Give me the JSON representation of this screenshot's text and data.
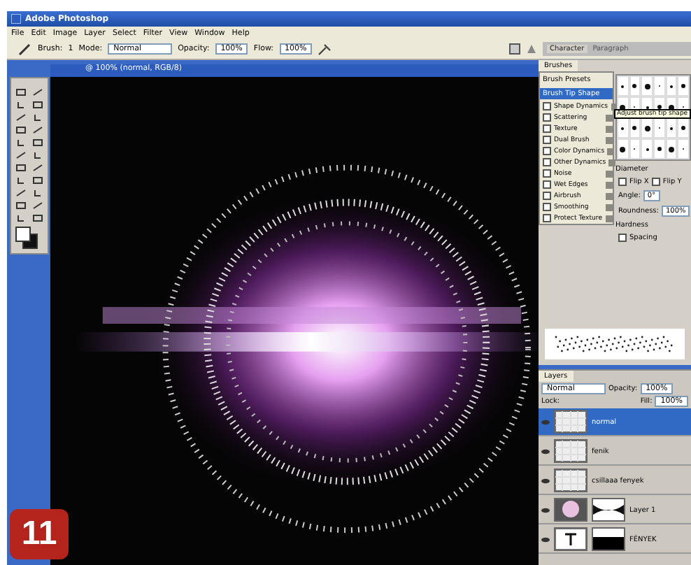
{
  "window": {
    "title": "Adobe Photoshop"
  },
  "menu": [
    "File",
    "Edit",
    "Image",
    "Layer",
    "Select",
    "Filter",
    "View",
    "Window",
    "Help"
  ],
  "options_bar": {
    "brush_label": "Brush:",
    "brush_size": "1",
    "mode_label": "Mode:",
    "mode": "Normal",
    "opacity_label": "Opacity:",
    "opacity": "100%",
    "flow_label": "Flow:",
    "flow": "100%"
  },
  "palette_tabs": [
    {
      "label": "Character",
      "selected": true
    },
    {
      "label": "Paragraph",
      "selected": false
    }
  ],
  "document": {
    "title": "@ 100% (normal, RGB/8)"
  },
  "brushes": {
    "title": "Brushes",
    "presets": "Brush Presets",
    "tip_shape": {
      "label": "Brush Tip Shape",
      "selected": true
    },
    "options": [
      {
        "label": "Shape Dynamics",
        "checked": false,
        "locked": true
      },
      {
        "label": "Scattering",
        "checked": false,
        "locked": true
      },
      {
        "label": "Texture",
        "checked": false,
        "locked": true
      },
      {
        "label": "Dual Brush",
        "checked": false,
        "locked": true
      },
      {
        "label": "Color Dynamics",
        "checked": false,
        "locked": true
      },
      {
        "label": "Other Dynamics",
        "checked": false,
        "locked": true
      },
      {
        "label": "Noise",
        "checked": false,
        "locked": true
      },
      {
        "label": "Wet Edges",
        "checked": false,
        "locked": true
      },
      {
        "label": "Airbrush",
        "checked": false,
        "locked": true
      },
      {
        "label": "Smoothing",
        "checked": false,
        "locked": true
      },
      {
        "label": "Protect Texture",
        "checked": false,
        "locked": true
      }
    ],
    "tooltip": "Adjust brush tip shape",
    "diameter_label": "Diameter",
    "flip_x": {
      "label": "Flip X",
      "checked": false
    },
    "flip_y": {
      "label": "Flip Y",
      "checked": false
    },
    "angle_label": "Angle:",
    "angle": "0°",
    "roundness_label": "Roundness:",
    "roundness": "100%",
    "hardness_label": "Hardness",
    "spacing": {
      "label": "Spacing",
      "checked": false
    }
  },
  "layers": {
    "title": "Layers",
    "blend_mode": "Normal",
    "opacity_label": "Opacity:",
    "opacity": "100%",
    "lock_label": "Lock:",
    "fill_label": "Fill:",
    "fill": "100%",
    "rows": [
      {
        "name": "normal",
        "kind": "plain",
        "selected": true
      },
      {
        "name": "fenik",
        "kind": "plain",
        "selected": false
      },
      {
        "name": "csillaaa fenyek",
        "kind": "plain",
        "selected": false
      },
      {
        "name": "Layer 1",
        "kind": "masked",
        "selected": false
      },
      {
        "name": "FÉNYEK",
        "kind": "text",
        "selected": false
      }
    ]
  },
  "step_badge": "11"
}
